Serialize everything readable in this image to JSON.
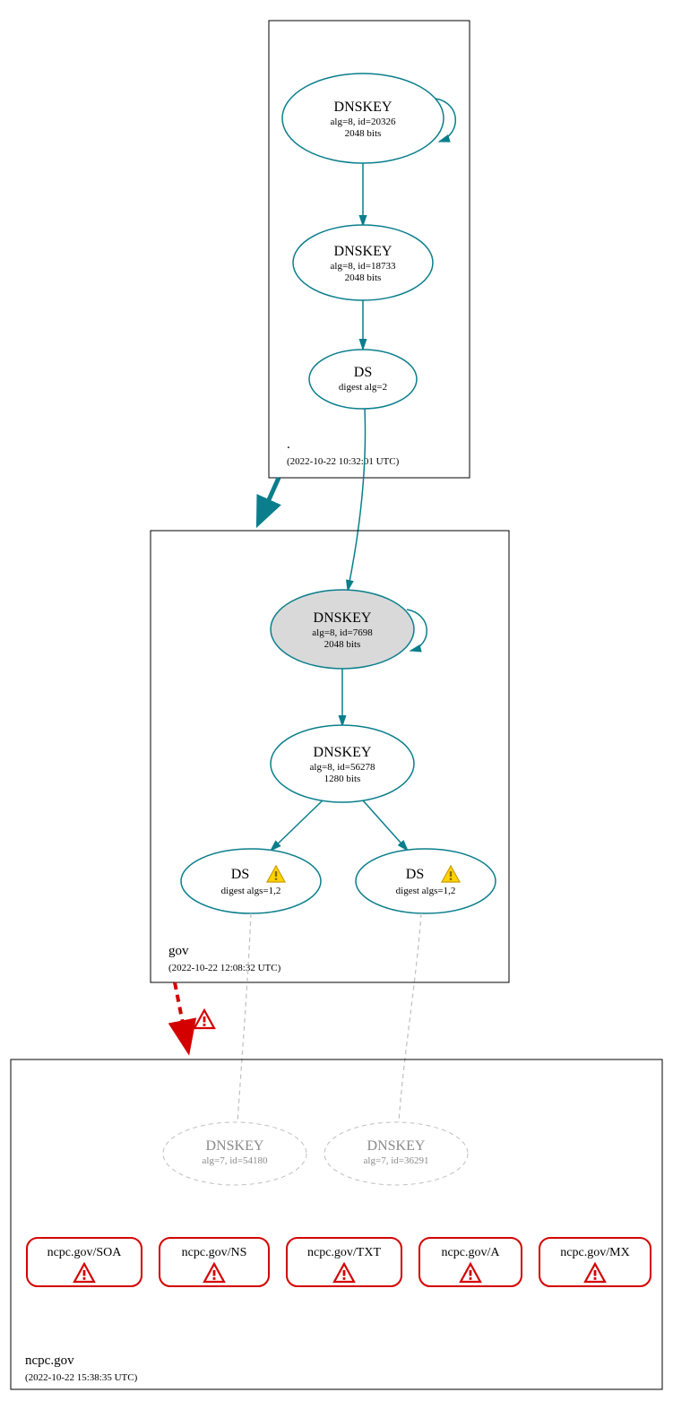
{
  "zones": {
    "root": {
      "label": ".",
      "timestamp": "(2022-10-22 10:32:01 UTC)"
    },
    "gov": {
      "label": "gov",
      "timestamp": "(2022-10-22 12:08:32 UTC)"
    },
    "ncpc": {
      "label": "ncpc.gov",
      "timestamp": "(2022-10-22 15:38:35 UTC)"
    }
  },
  "nodes": {
    "rootKsk": {
      "title": "DNSKEY",
      "line1": "alg=8, id=20326",
      "line2": "2048 bits"
    },
    "rootZsk": {
      "title": "DNSKEY",
      "line1": "alg=8, id=18733",
      "line2": "2048 bits"
    },
    "rootDs": {
      "title": "DS",
      "line1": "digest alg=2"
    },
    "govKsk": {
      "title": "DNSKEY",
      "line1": "alg=8, id=7698",
      "line2": "2048 bits"
    },
    "govZsk": {
      "title": "DNSKEY",
      "line1": "alg=8, id=56278",
      "line2": "1280 bits"
    },
    "govDs1": {
      "title": "DS",
      "line1": "digest algs=1,2"
    },
    "govDs2": {
      "title": "DS",
      "line1": "digest algs=1,2"
    },
    "ncpcKey1": {
      "title": "DNSKEY",
      "line1": "alg=7, id=54180"
    },
    "ncpcKey2": {
      "title": "DNSKEY",
      "line1": "alg=7, id=36291"
    }
  },
  "records": {
    "soa": "ncpc.gov/SOA",
    "ns": "ncpc.gov/NS",
    "txt": "ncpc.gov/TXT",
    "a": "ncpc.gov/A",
    "mx": "ncpc.gov/MX"
  },
  "icons": {
    "warnYellow": "warning-icon",
    "warnRed": "error-icon"
  }
}
